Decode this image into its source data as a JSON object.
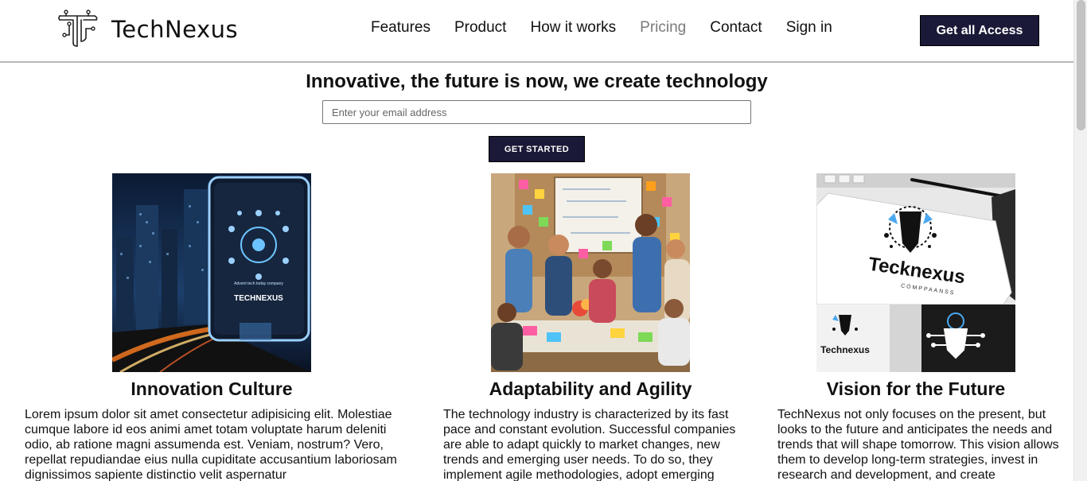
{
  "brand": {
    "name": "TechNexus",
    "logo_icon": "tech-circuit-t-logo"
  },
  "nav": {
    "items": [
      {
        "label": "Features",
        "muted": false
      },
      {
        "label": "Product",
        "muted": false
      },
      {
        "label": "How it works",
        "muted": false
      },
      {
        "label": "Pricing",
        "muted": true
      },
      {
        "label": "Contact",
        "muted": false
      },
      {
        "label": "Sign in",
        "muted": false
      }
    ],
    "cta_label": "Get all Access"
  },
  "hero": {
    "title": "Innovative, the future is now, we create technology",
    "email_placeholder": "Enter your email address",
    "button_label": "GET STARTED"
  },
  "cards": [
    {
      "title": "Innovation Culture",
      "image_text": "TECHNEXUS",
      "image_subtext": "Advent tech today company",
      "text": "Lorem ipsum dolor sit amet consectetur adipisicing elit. Molestiae cumque labore id eos animi amet totam voluptate harum deleniti odio, ab ratione magni assumenda est. Veniam, nostrum? Vero, repellat repudiandae eius nulla cupiditate accusantium laboriosam dignissimos sapiente distinctio velit aspernatur"
    },
    {
      "title": "Adaptability and Agility",
      "text": "The technology industry is characterized by its fast pace and constant evolution. Successful companies are able to adapt quickly to market changes, new trends and emerging user needs. To do so, they implement agile methodologies, adopt emerging"
    },
    {
      "title": "Vision for the Future",
      "image_text": "Tecknexus",
      "image_subtext": "COMPPAANSS",
      "image_small_text": "Technexus",
      "text": "TechNexus not only focuses on the present, but looks to the future and anticipates the needs and trends that will shape tomorrow. This vision allows them to develop long-term strategies, invest in research and development, and create"
    }
  ],
  "colors": {
    "primary_dark": "#1a1937",
    "muted_nav": "#7a7a7a",
    "header_border": "#b8b8b8"
  }
}
